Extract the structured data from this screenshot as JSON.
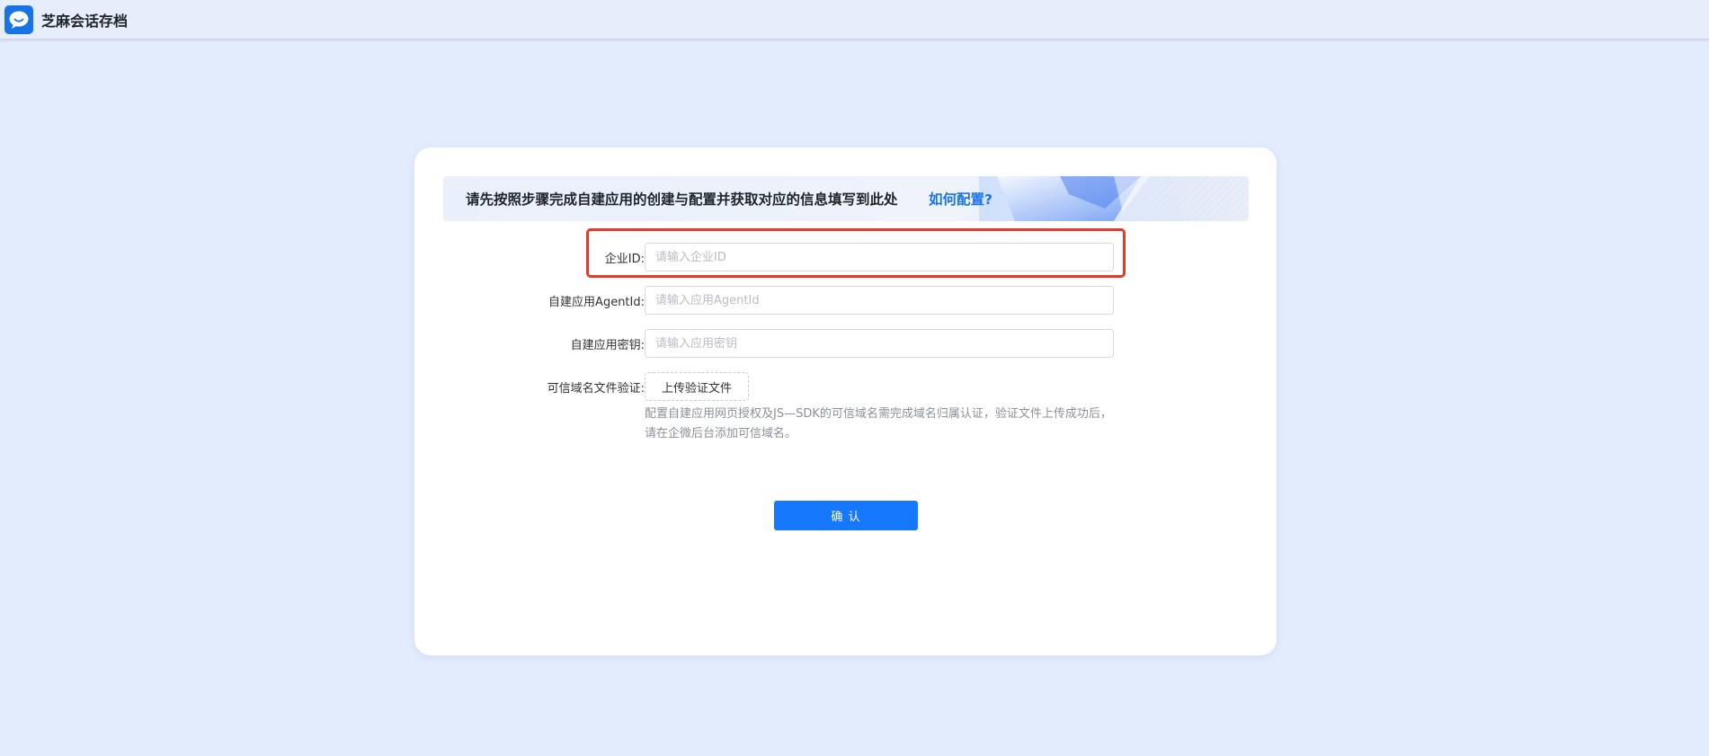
{
  "app": {
    "title": "芝麻会话存档",
    "logo_icon": "chat-bubble-icon",
    "brand_color": "#1874e6"
  },
  "banner": {
    "text": "请先按照步骤完成自建应用的创建与配置并获取对应的信息填写到此处",
    "link_label": "如何配置?"
  },
  "form": {
    "corp_id": {
      "label": "企业ID:",
      "placeholder": "请输入企业ID",
      "value": ""
    },
    "agent_id": {
      "label": "自建应用AgentId:",
      "placeholder": "请输入应用AgentId",
      "value": ""
    },
    "secret": {
      "label": "自建应用密钥:",
      "placeholder": "请输入应用密钥",
      "value": ""
    },
    "domain_verify": {
      "label": "可信域名文件验证:",
      "upload_label": "上传验证文件",
      "hint": "配置自建应用网页授权及JS—SDK的可信域名需完成域名归属认证，验证文件上传成功后，请在企微后台添加可信域名。"
    }
  },
  "actions": {
    "confirm_label": "确 认"
  },
  "colors": {
    "primary": "#1677ff",
    "highlight_border": "#e23b2e",
    "link": "#1a73e8"
  }
}
